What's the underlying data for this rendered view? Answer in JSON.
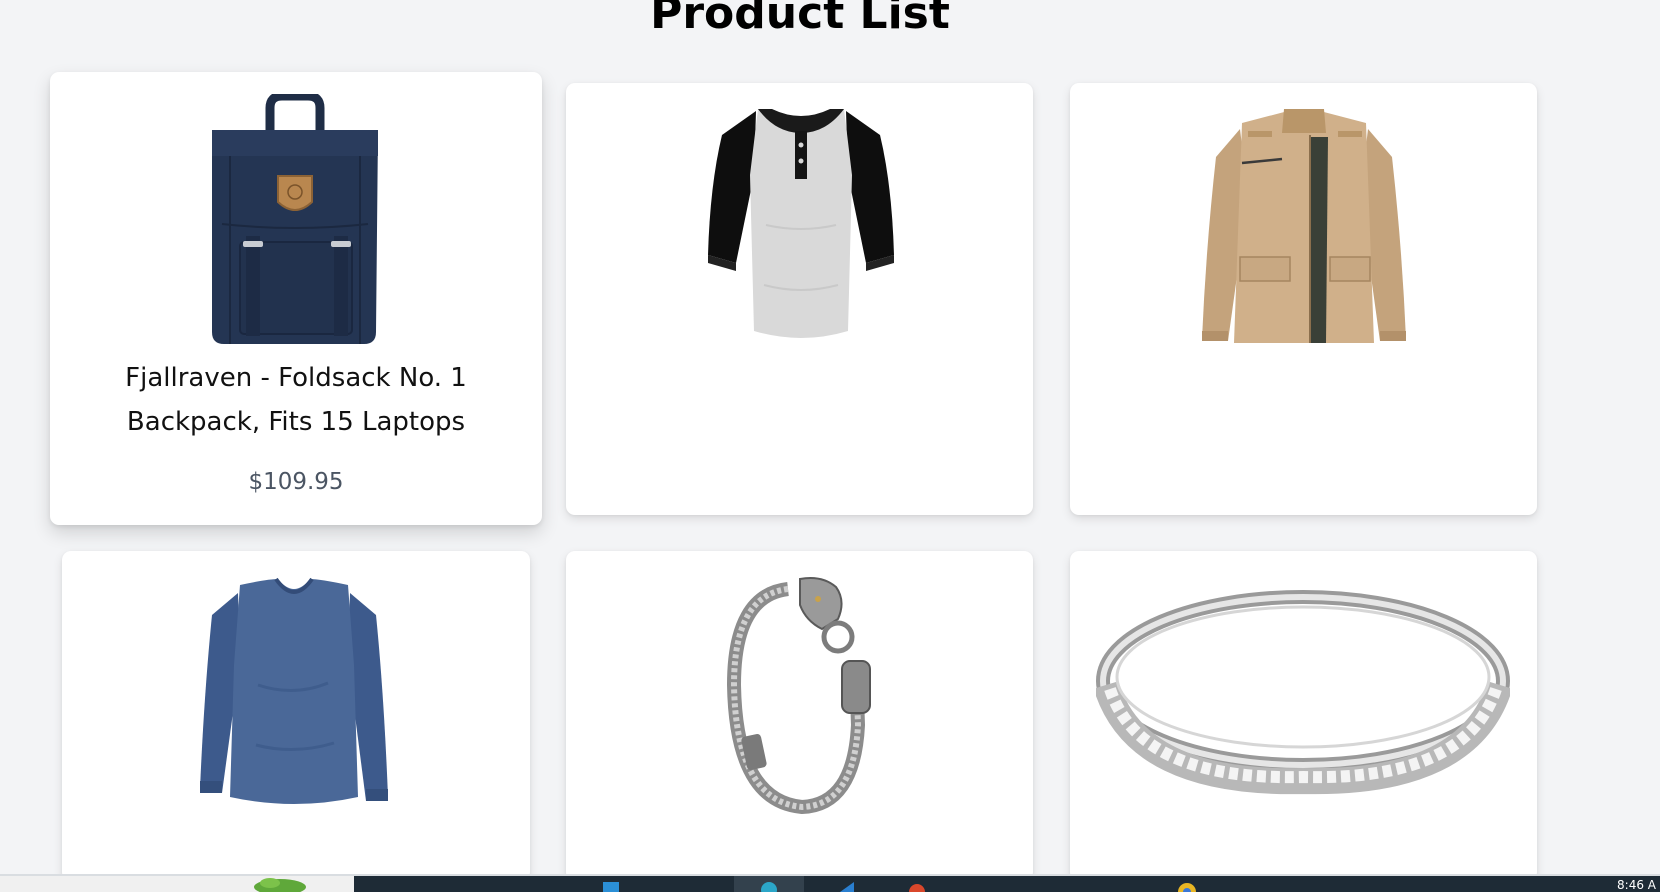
{
  "page": {
    "title": "Product List"
  },
  "products": [
    {
      "title": "Fjallraven - Foldsack No. 1 Backpack, Fits 15 Laptops",
      "price": "$109.95",
      "image": "navy-backpack"
    },
    {
      "title": "",
      "price": "",
      "image": "raglan-henley-shirt"
    },
    {
      "title": "",
      "price": "",
      "image": "khaki-jacket"
    },
    {
      "title": "",
      "price": "",
      "image": "blue-long-sleeve-shirt"
    },
    {
      "title": "",
      "price": "",
      "image": "dragon-chain-bracelet"
    },
    {
      "title": "",
      "price": "",
      "image": "silver-eternity-ring"
    }
  ],
  "taskbar": {
    "clock": "8:46 A"
  },
  "colors": {
    "background": "#f3f4f6",
    "card": "#ffffff",
    "price_text": "#4b5563",
    "taskbar": "#1e2b36"
  }
}
